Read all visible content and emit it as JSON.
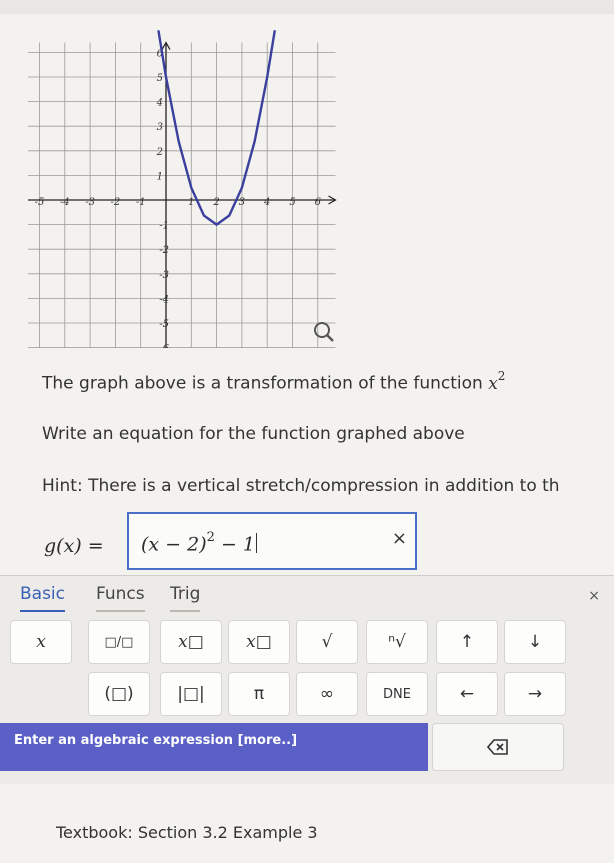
{
  "chart_data": {
    "type": "line",
    "x_ticks": [
      "-6",
      "-5",
      "-4",
      "-3",
      "-2",
      "-1",
      "1",
      "2",
      "3",
      "4",
      "5",
      "6"
    ],
    "y_ticks": [
      "6",
      "5",
      "4",
      "3",
      "2",
      "1",
      "-1",
      "-2",
      "-3",
      "-4",
      "-5",
      "-6"
    ],
    "xlim": [
      -6.7,
      6.7
    ],
    "ylim": [
      -6.4,
      6.4
    ],
    "grid": true,
    "curve": {
      "x": [
        -0.3,
        0,
        0.5,
        1,
        1.5,
        2,
        2.5,
        3,
        3.5,
        4,
        4.3
      ],
      "y": [
        6.94,
        5,
        2.38,
        0.5,
        -0.63,
        -1,
        -0.63,
        0.5,
        2.38,
        5,
        6.94
      ]
    },
    "curve_color": "#3b3f9e",
    "magnifier_icon": "magnifier-icon"
  },
  "question": {
    "line1": "The graph above is a transformation of the function",
    "base_function": "x",
    "base_exponent": "2",
    "line2": "Write an equation for the function graphed above",
    "hint": "Hint: There is a vertical stretch/compression in addition to th"
  },
  "answer": {
    "label": "g(x) =",
    "value_base": "(x − 2)",
    "value_exp": "2",
    "value_tail": " − 1",
    "clear": "×"
  },
  "palette": {
    "tabs": [
      "Basic",
      "Funcs",
      "Trig"
    ],
    "close": "×",
    "row1": [
      "x",
      "□/□",
      "x□",
      "x□",
      "√",
      "ⁿ√",
      "↑",
      "↓"
    ],
    "row2": [
      "(□)",
      "|□|",
      "π",
      "∞",
      "DNE",
      "←",
      "→"
    ],
    "status": "Enter an algebraic expression [more..]",
    "backspace_icon": "backspace-icon"
  },
  "footer": {
    "textbook": "Textbook: Section 3.2 Example 3"
  },
  "colors": {
    "accent": "#3a5fb8",
    "status_bar": "#5a60c6"
  }
}
